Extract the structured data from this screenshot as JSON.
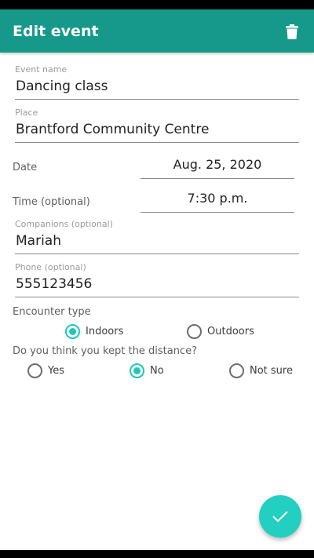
{
  "app_bar": {
    "title": "Edit event",
    "delete_icon": "trash-icon"
  },
  "fields": {
    "event_name": {
      "label": "Event name",
      "value": "Dancing class"
    },
    "place": {
      "label": "Place",
      "value": "Brantford Community Centre"
    },
    "date": {
      "label": "Date",
      "value": "Aug. 25, 2020"
    },
    "time": {
      "label": "Time (optional)",
      "value": "7:30 p.m."
    },
    "companions": {
      "label": "Companions (optional)",
      "value": "Mariah"
    },
    "phone": {
      "label": "Phone (optional)",
      "value": "555123456"
    }
  },
  "encounter_type": {
    "label": "Encounter type",
    "options": [
      {
        "label": "Indoors",
        "checked": true
      },
      {
        "label": "Outdoors",
        "checked": false
      }
    ]
  },
  "distance": {
    "label": "Do you think you kept the distance?",
    "options": [
      {
        "label": "Yes",
        "checked": false
      },
      {
        "label": "No",
        "checked": true
      },
      {
        "label": "Not sure",
        "checked": false
      }
    ]
  },
  "fab": {
    "icon": "check-icon"
  },
  "colors": {
    "app_bar": "#16998a",
    "accent": "#1dc8b7",
    "fab": "#22cfc0"
  }
}
